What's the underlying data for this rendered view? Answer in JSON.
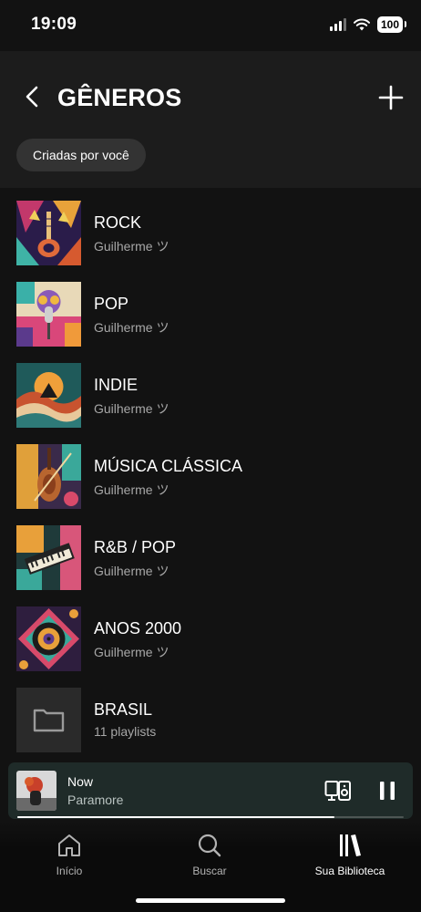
{
  "status_bar": {
    "time": "19:09",
    "battery": "100"
  },
  "header": {
    "title": "GÊNEROS",
    "filter_chip": "Criadas por você"
  },
  "items": [
    {
      "title": "ROCK",
      "subtitle": "Guilherme ツ",
      "icon": "rock-cover"
    },
    {
      "title": "POP",
      "subtitle": "Guilherme ツ",
      "icon": "pop-cover"
    },
    {
      "title": "INDIE",
      "subtitle": "Guilherme ツ",
      "icon": "indie-cover"
    },
    {
      "title": "MÚSICA CLÁSSICA",
      "subtitle": "Guilherme ツ",
      "icon": "classical-cover"
    },
    {
      "title": "R&B / POP",
      "subtitle": "Guilherme ツ",
      "icon": "rnb-cover"
    },
    {
      "title": "ANOS 2000",
      "subtitle": "Guilherme ツ",
      "icon": "anos-2000-cover"
    },
    {
      "title": "BRASIL",
      "subtitle": "11 playlists",
      "icon": "folder-icon"
    }
  ],
  "now_playing": {
    "title": "Now",
    "artist": "Paramore",
    "progress": 0.82
  },
  "nav": {
    "home": "Início",
    "search": "Buscar",
    "library": "Sua Biblioteca"
  },
  "colors": {
    "background": "#121212",
    "header": "#1c1c1c",
    "mini_player": "#1f2b29",
    "chip": "#333333"
  }
}
